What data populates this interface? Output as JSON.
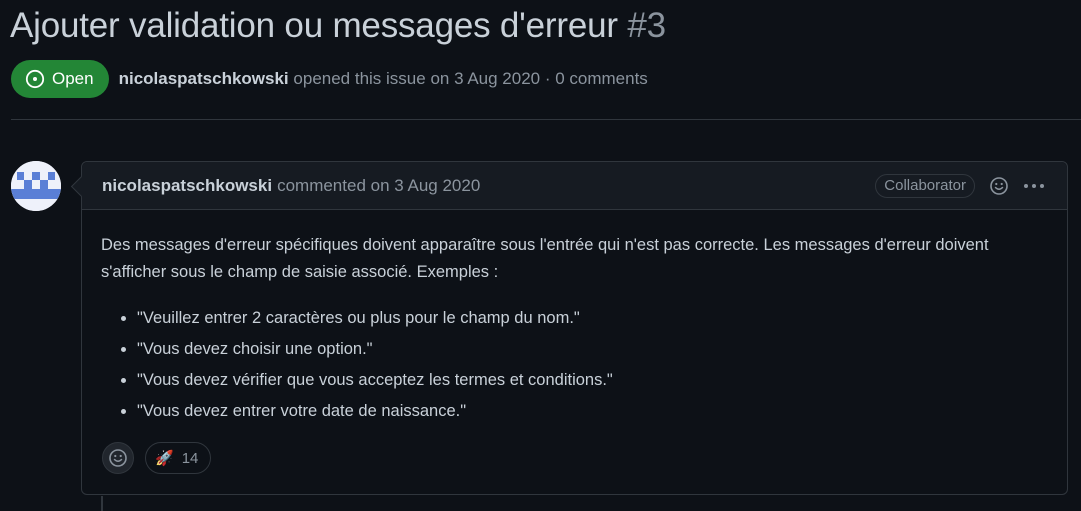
{
  "issue": {
    "title": "Ajouter validation ou messages d'erreur",
    "number": "#3",
    "state_label": "Open",
    "author": "nicolaspatschkowski",
    "opened_text": "opened this issue on 3 Aug 2020 · 0 comments",
    "colors": {
      "open": "#238636",
      "background": "#0d1117",
      "border": "#30363d"
    }
  },
  "comment": {
    "author": "nicolaspatschkowski",
    "meta_text": "commented on 3 Aug 2020",
    "role_badge": "Collaborator",
    "body_paragraph": "Des messages d'erreur spécifiques doivent apparaître sous l'entrée qui n'est pas correcte. Les messages d'erreur doivent s'afficher sous le champ de saisie associé. Exemples :",
    "body_items": [
      "\"Veuillez entrer 2 caractères ou plus pour le champ du nom.\"",
      "\"Vous devez choisir une option.\"",
      "\"Vous devez vérifier que vous acceptez les termes et conditions.\"",
      "\"Vous devez entrer votre date de naissance.\""
    ],
    "reactions": [
      {
        "emoji": "🚀",
        "icon": "rocket-icon",
        "count": "14"
      }
    ]
  }
}
